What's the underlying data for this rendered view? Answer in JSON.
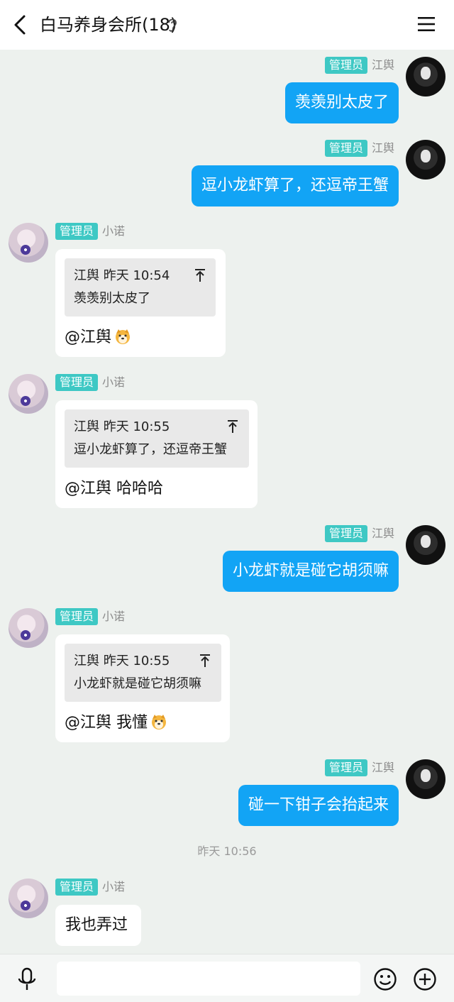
{
  "header": {
    "title": "白马养身会所(18)",
    "icons": [
      "back-icon",
      "ear-icon",
      "menu-icon"
    ]
  },
  "chat": {
    "messages": [
      {
        "direction": "out",
        "badge": "管理员",
        "nick": "江舆",
        "text": "羡羡别太皮了"
      },
      {
        "direction": "out",
        "badge": "管理员",
        "nick": "江舆",
        "text": "逗小龙虾算了，还逗帝王蟹"
      },
      {
        "direction": "in",
        "badge": "管理员",
        "nick": "小诺",
        "quote": {
          "author": "江舆",
          "time": "昨天 10:54",
          "text": "羡羡别太皮了"
        },
        "text": "@江舆",
        "emoji": "dog-emoji"
      },
      {
        "direction": "in",
        "badge": "管理员",
        "nick": "小诺",
        "quote": {
          "author": "江舆",
          "time": "昨天 10:55",
          "text": "逗小龙虾算了，还逗帝王蟹"
        },
        "text": "@江舆 哈哈哈"
      },
      {
        "direction": "out",
        "badge": "管理员",
        "nick": "江舆",
        "text": "小龙虾就是碰它胡须嘛"
      },
      {
        "direction": "in",
        "badge": "管理员",
        "nick": "小诺",
        "quote": {
          "author": "江舆",
          "time": "昨天 10:55",
          "text": "小龙虾就是碰它胡须嘛"
        },
        "text": "@江舆 我懂",
        "emoji": "dog-emoji"
      },
      {
        "direction": "out",
        "badge": "管理员",
        "nick": "江舆",
        "text": "碰一下钳子会抬起来"
      },
      {
        "direction": "timestamp",
        "text": "昨天 10:56"
      },
      {
        "direction": "in",
        "badge": "管理员",
        "nick": "小诺",
        "text": "我也弄过"
      }
    ]
  },
  "input_bar": {
    "placeholder": "",
    "icons": [
      "mic-icon",
      "emoji-icon",
      "plus-icon"
    ]
  },
  "colors": {
    "background": "#edf1ee",
    "bubble_out": "#12a4f5",
    "badge": "#3ec8c4"
  }
}
